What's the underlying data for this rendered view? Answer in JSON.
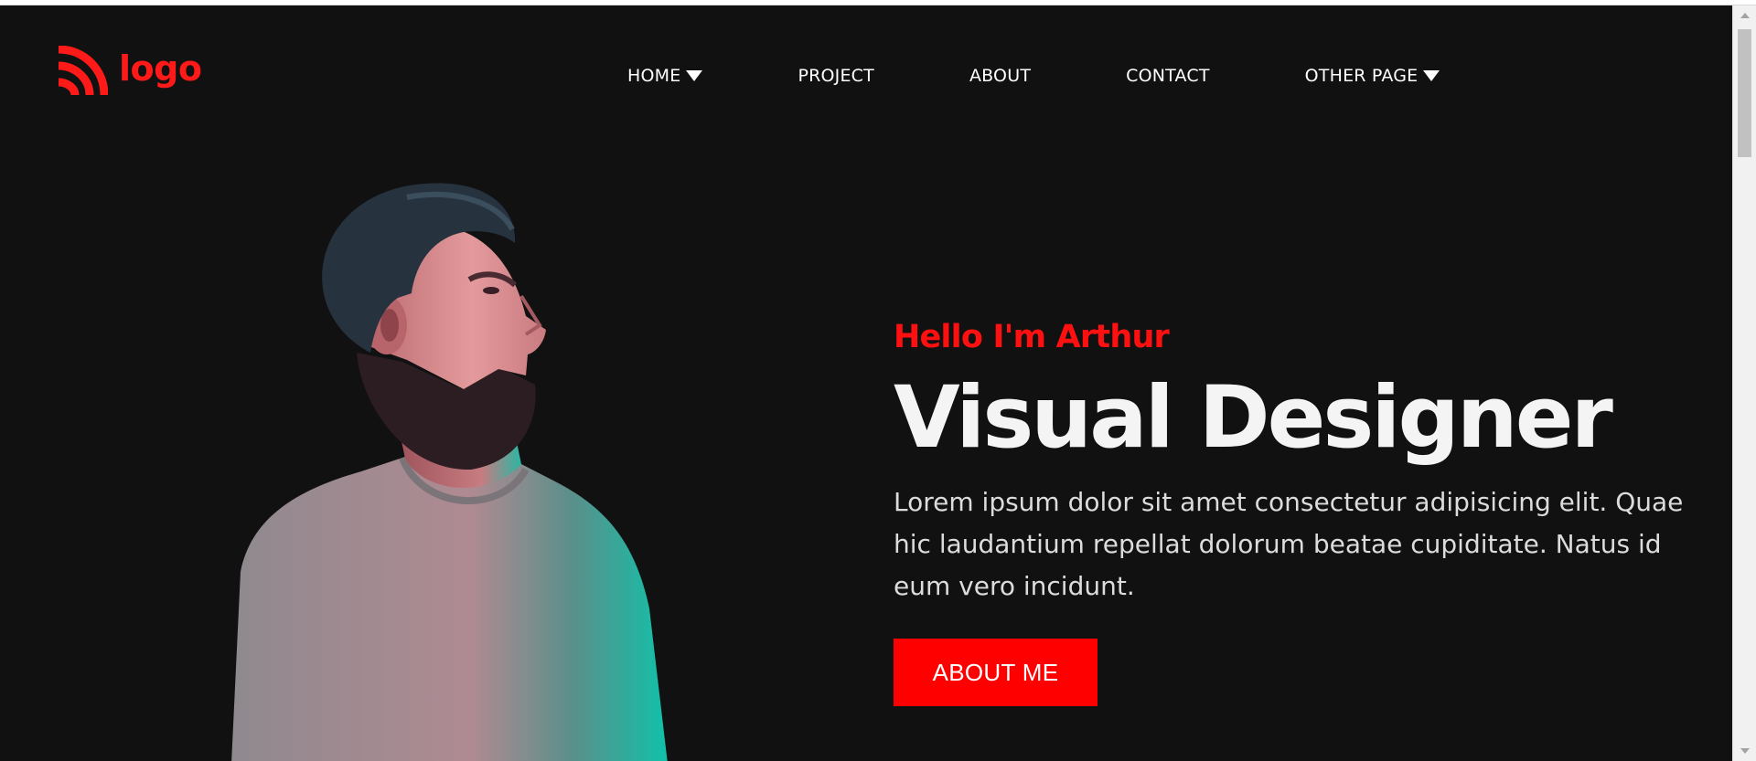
{
  "brand": {
    "logo_text": "logo",
    "accent_color": "#ff1a1a",
    "logo_icon": "signal-arcs-icon"
  },
  "nav": {
    "items": [
      {
        "label": "HOME",
        "has_dropdown": true
      },
      {
        "label": "PROJECT",
        "has_dropdown": false
      },
      {
        "label": "ABOUT",
        "has_dropdown": false
      },
      {
        "label": "CONTACT",
        "has_dropdown": false
      },
      {
        "label": "OTHER PAGE",
        "has_dropdown": true
      }
    ]
  },
  "hero": {
    "greeting": "Hello I'm Arthur",
    "title": "Visual Designer",
    "description_lines": [
      "Lorem ipsum dolor sit amet consectetur adipisicing elit. Quae",
      "hic laudantium repellat dolorum beatae cupiditate. Natus id",
      "eum vero incidunt."
    ],
    "cta_label": "ABOUT ME",
    "cta_color": "#ff0000",
    "background_color": "#111111"
  }
}
